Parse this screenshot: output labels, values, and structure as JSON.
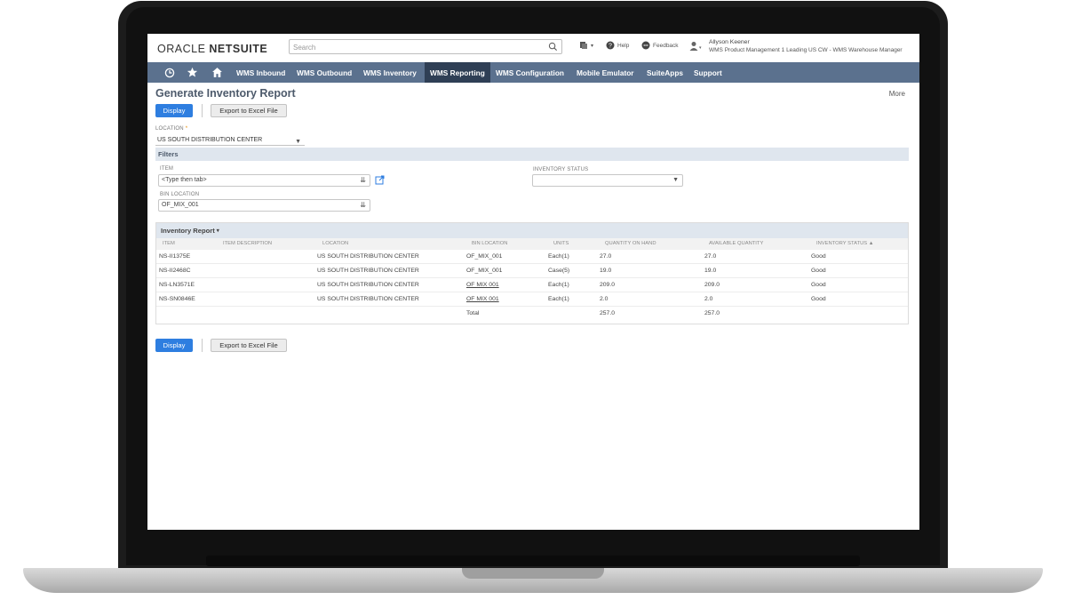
{
  "brand": {
    "oracle": "ORACLE",
    "netsuite": "NETSUITE"
  },
  "search": {
    "placeholder": "Search"
  },
  "topbar": {
    "help_label": "Help",
    "feedback_label": "Feedback",
    "user_name": "Allyson Keener",
    "user_role": "WMS Product Management 1 Leading US CW - WMS Warehouse Manager"
  },
  "nav": {
    "items": [
      {
        "label": "WMS Inbound"
      },
      {
        "label": "WMS Outbound"
      },
      {
        "label": "WMS Inventory"
      },
      {
        "label": "WMS Reporting",
        "active": true
      },
      {
        "label": "WMS Configuration"
      },
      {
        "label": "Mobile Emulator"
      },
      {
        "label": "SuiteApps"
      },
      {
        "label": "Support"
      }
    ]
  },
  "page": {
    "title": "Generate Inventory Report",
    "more_label": "More",
    "display_label": "Display",
    "export_label": "Export to Excel File"
  },
  "location": {
    "label": "LOCATION",
    "required_mark": "*",
    "value": "US SOUTH DISTRIBUTION CENTER"
  },
  "filters": {
    "title": "Filters",
    "item_label": "ITEM",
    "item_placeholder": "<Type then tab>",
    "bin_label": "BIN LOCATION",
    "bin_value": "OF_MIX_001",
    "status_label": "INVENTORY STATUS",
    "status_value": ""
  },
  "report": {
    "title": "Inventory Report",
    "title_marker": "▾",
    "columns": [
      "ITEM",
      "ITEM DESCRIPTION",
      "LOCATION",
      "BIN LOCATION",
      "UNITS",
      "QUANTITY ON HAND",
      "AVAILABLE QUANTITY",
      "INVENTORY STATUS ▲"
    ],
    "rows": [
      {
        "item": "NS-II1375E",
        "description": "",
        "location": "US SOUTH DISTRIBUTION CENTER",
        "bin": "OF_MIX_001",
        "units": "Each(1)",
        "qoh": "27.0",
        "avail": "27.0",
        "status": "Good"
      },
      {
        "item": "NS-II2468C",
        "description": "",
        "location": "US SOUTH DISTRIBUTION CENTER",
        "bin": "OF_MIX_001",
        "units": "Case(5)",
        "qoh": "19.0",
        "avail": "19.0",
        "status": "Good"
      },
      {
        "item": "NS-LN3571E",
        "description": "",
        "location": "US SOUTH DISTRIBUTION CENTER",
        "bin": "OF MIX 001",
        "units": "Each(1)",
        "qoh": "209.0",
        "avail": "209.0",
        "status": "Good"
      },
      {
        "item": "NS-SN0846E",
        "description": "",
        "location": "US SOUTH DISTRIBUTION CENTER",
        "bin": "OF MIX 001",
        "units": "Each(1)",
        "qoh": "2.0",
        "avail": "2.0",
        "status": "Good"
      }
    ],
    "total_label": "Total",
    "total_qoh": "257.0",
    "total_avail": "257.0"
  },
  "colors": {
    "nav_bg": "#5b718e",
    "nav_active": "#2f3f55",
    "primary_button": "#2e7ee0",
    "section_bg": "#dfe6ee"
  }
}
